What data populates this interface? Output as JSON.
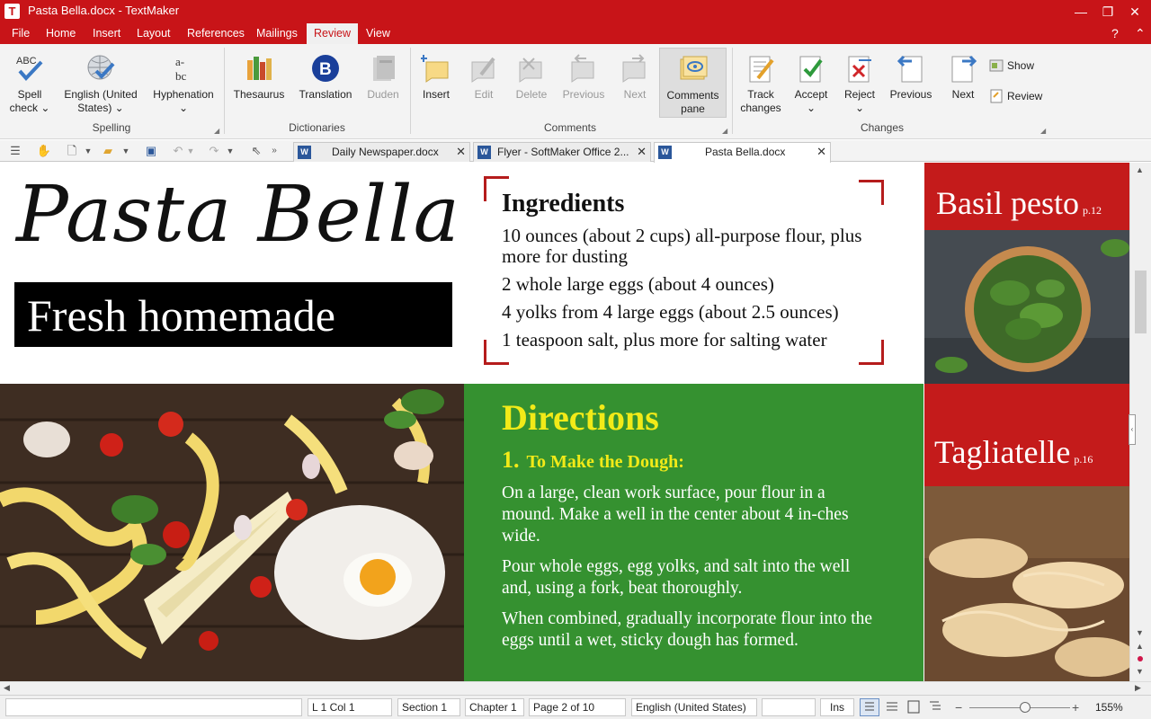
{
  "window": {
    "title": "Pasta Bella.docx - TextMaker",
    "app_icon_letter": "T",
    "minimize": "—",
    "maximize": "❐",
    "close": "✕"
  },
  "menu": {
    "items": [
      "File",
      "Home",
      "Insert",
      "Layout",
      "References",
      "Mailings",
      "Review",
      "View"
    ],
    "active": "Review",
    "help": "?",
    "collapse": "⌃"
  },
  "ribbon": {
    "spelling": {
      "group_label": "Spelling",
      "spell_check": "Spell check",
      "language": "English (United States)",
      "hyphenation": "Hyphenation"
    },
    "dictionaries": {
      "group_label": "Dictionaries",
      "thesaurus": "Thesaurus",
      "translation": "Translation",
      "duden": "Duden"
    },
    "comments": {
      "group_label": "Comments",
      "insert": "Insert",
      "edit": "Edit",
      "delete": "Delete",
      "previous": "Previous",
      "next": "Next",
      "comments_pane": "Comments pane"
    },
    "changes": {
      "group_label": "Changes",
      "track_changes": "Track changes",
      "accept": "Accept",
      "reject": "Reject",
      "previous": "Previous",
      "next": "Next",
      "show": "Show",
      "review": "Review"
    }
  },
  "tabs": [
    {
      "label": "Daily Newspaper.docx",
      "active": false
    },
    {
      "label": "Flyer - SoftMaker Office 2...",
      "active": false
    },
    {
      "label": "Pasta Bella.docx",
      "active": true
    }
  ],
  "document": {
    "title": "Pasta  Bella",
    "subtitle": "Fresh homemade",
    "ingredients_title": "Ingredients",
    "ingredients": [
      "10 ounces (about 2 cups) all-purpose flour, plus more for dusting",
      "2 whole large eggs (about 4 ounces)",
      "4 yolks from 4 large eggs (about 2.5 ounces)",
      "1 teaspoon salt, plus more for salting water"
    ],
    "sidebar": [
      {
        "title": "Basil pesto",
        "page": "p.12"
      },
      {
        "title": "Tagliatelle",
        "page": "p.16"
      }
    ],
    "directions_title": "Directions",
    "step_number": "1.",
    "step_title": "To Make the Dough:",
    "paragraphs": [
      "On a large, clean work surface, pour flour in a mound. Make a well in the center about 4 in-ches wide.",
      "Pour whole eggs, egg yolks, and salt into the well and, using a fork, beat thoroughly.",
      "When combined, gradually incorporate flour into the eggs until a wet, sticky dough has formed."
    ]
  },
  "status": {
    "position": "L 1 Col 1",
    "section": "Section 1",
    "chapter": "Chapter 1",
    "page": "Page 2 of 10",
    "language": "English (United States)",
    "mode": "Ins",
    "zoom": "155%"
  },
  "colors": {
    "brand_red": "#c81418",
    "directions_green": "#359130",
    "directions_yellow": "#f2ea18"
  }
}
